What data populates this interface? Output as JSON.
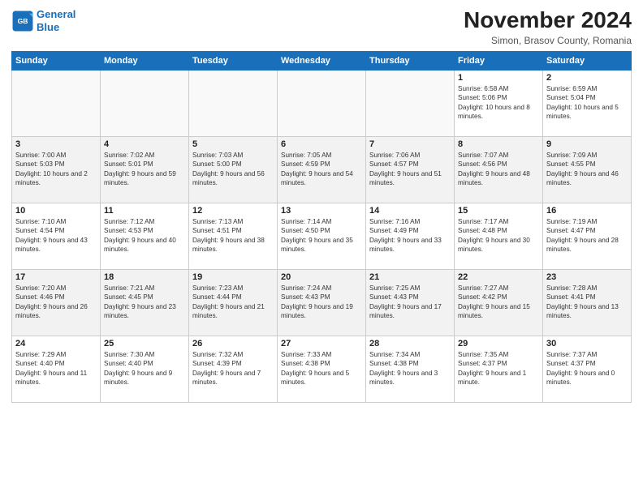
{
  "header": {
    "logo_line1": "General",
    "logo_line2": "Blue",
    "month": "November 2024",
    "location": "Simon, Brasov County, Romania"
  },
  "weekdays": [
    "Sunday",
    "Monday",
    "Tuesday",
    "Wednesday",
    "Thursday",
    "Friday",
    "Saturday"
  ],
  "weeks": [
    [
      {
        "day": "",
        "info": ""
      },
      {
        "day": "",
        "info": ""
      },
      {
        "day": "",
        "info": ""
      },
      {
        "day": "",
        "info": ""
      },
      {
        "day": "",
        "info": ""
      },
      {
        "day": "1",
        "info": "Sunrise: 6:58 AM\nSunset: 5:06 PM\nDaylight: 10 hours and 8 minutes."
      },
      {
        "day": "2",
        "info": "Sunrise: 6:59 AM\nSunset: 5:04 PM\nDaylight: 10 hours and 5 minutes."
      }
    ],
    [
      {
        "day": "3",
        "info": "Sunrise: 7:00 AM\nSunset: 5:03 PM\nDaylight: 10 hours and 2 minutes."
      },
      {
        "day": "4",
        "info": "Sunrise: 7:02 AM\nSunset: 5:01 PM\nDaylight: 9 hours and 59 minutes."
      },
      {
        "day": "5",
        "info": "Sunrise: 7:03 AM\nSunset: 5:00 PM\nDaylight: 9 hours and 56 minutes."
      },
      {
        "day": "6",
        "info": "Sunrise: 7:05 AM\nSunset: 4:59 PM\nDaylight: 9 hours and 54 minutes."
      },
      {
        "day": "7",
        "info": "Sunrise: 7:06 AM\nSunset: 4:57 PM\nDaylight: 9 hours and 51 minutes."
      },
      {
        "day": "8",
        "info": "Sunrise: 7:07 AM\nSunset: 4:56 PM\nDaylight: 9 hours and 48 minutes."
      },
      {
        "day": "9",
        "info": "Sunrise: 7:09 AM\nSunset: 4:55 PM\nDaylight: 9 hours and 46 minutes."
      }
    ],
    [
      {
        "day": "10",
        "info": "Sunrise: 7:10 AM\nSunset: 4:54 PM\nDaylight: 9 hours and 43 minutes."
      },
      {
        "day": "11",
        "info": "Sunrise: 7:12 AM\nSunset: 4:53 PM\nDaylight: 9 hours and 40 minutes."
      },
      {
        "day": "12",
        "info": "Sunrise: 7:13 AM\nSunset: 4:51 PM\nDaylight: 9 hours and 38 minutes."
      },
      {
        "day": "13",
        "info": "Sunrise: 7:14 AM\nSunset: 4:50 PM\nDaylight: 9 hours and 35 minutes."
      },
      {
        "day": "14",
        "info": "Sunrise: 7:16 AM\nSunset: 4:49 PM\nDaylight: 9 hours and 33 minutes."
      },
      {
        "day": "15",
        "info": "Sunrise: 7:17 AM\nSunset: 4:48 PM\nDaylight: 9 hours and 30 minutes."
      },
      {
        "day": "16",
        "info": "Sunrise: 7:19 AM\nSunset: 4:47 PM\nDaylight: 9 hours and 28 minutes."
      }
    ],
    [
      {
        "day": "17",
        "info": "Sunrise: 7:20 AM\nSunset: 4:46 PM\nDaylight: 9 hours and 26 minutes."
      },
      {
        "day": "18",
        "info": "Sunrise: 7:21 AM\nSunset: 4:45 PM\nDaylight: 9 hours and 23 minutes."
      },
      {
        "day": "19",
        "info": "Sunrise: 7:23 AM\nSunset: 4:44 PM\nDaylight: 9 hours and 21 minutes."
      },
      {
        "day": "20",
        "info": "Sunrise: 7:24 AM\nSunset: 4:43 PM\nDaylight: 9 hours and 19 minutes."
      },
      {
        "day": "21",
        "info": "Sunrise: 7:25 AM\nSunset: 4:43 PM\nDaylight: 9 hours and 17 minutes."
      },
      {
        "day": "22",
        "info": "Sunrise: 7:27 AM\nSunset: 4:42 PM\nDaylight: 9 hours and 15 minutes."
      },
      {
        "day": "23",
        "info": "Sunrise: 7:28 AM\nSunset: 4:41 PM\nDaylight: 9 hours and 13 minutes."
      }
    ],
    [
      {
        "day": "24",
        "info": "Sunrise: 7:29 AM\nSunset: 4:40 PM\nDaylight: 9 hours and 11 minutes."
      },
      {
        "day": "25",
        "info": "Sunrise: 7:30 AM\nSunset: 4:40 PM\nDaylight: 9 hours and 9 minutes."
      },
      {
        "day": "26",
        "info": "Sunrise: 7:32 AM\nSunset: 4:39 PM\nDaylight: 9 hours and 7 minutes."
      },
      {
        "day": "27",
        "info": "Sunrise: 7:33 AM\nSunset: 4:38 PM\nDaylight: 9 hours and 5 minutes."
      },
      {
        "day": "28",
        "info": "Sunrise: 7:34 AM\nSunset: 4:38 PM\nDaylight: 9 hours and 3 minutes."
      },
      {
        "day": "29",
        "info": "Sunrise: 7:35 AM\nSunset: 4:37 PM\nDaylight: 9 hours and 1 minute."
      },
      {
        "day": "30",
        "info": "Sunrise: 7:37 AM\nSunset: 4:37 PM\nDaylight: 9 hours and 0 minutes."
      }
    ]
  ]
}
